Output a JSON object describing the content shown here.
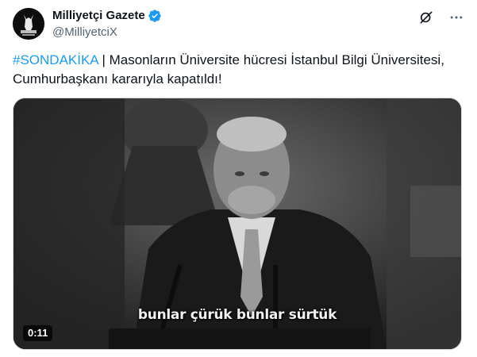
{
  "author": {
    "display_name": "Milliyetçi Gazete",
    "handle": "@MilliyetciX",
    "verified": true,
    "avatar_icon": "wolf-salute-logo-icon"
  },
  "actions": {
    "grok_icon": "grok-icon",
    "more_icon": "more-icon"
  },
  "tweet": {
    "hashtag": "#SONDAKİKA",
    "text": " | Masonların Üniversite hücresi İstanbul Bilgi Üniversitesi, Cumhurbaşkanı kararıyla kapatıldı!"
  },
  "video": {
    "caption": "bunlar çürük bunlar sürtük",
    "duration": "0:11"
  },
  "colors": {
    "hashtag": "#1d9bf0",
    "verified": "#1d9bf0",
    "handle": "#536471"
  }
}
